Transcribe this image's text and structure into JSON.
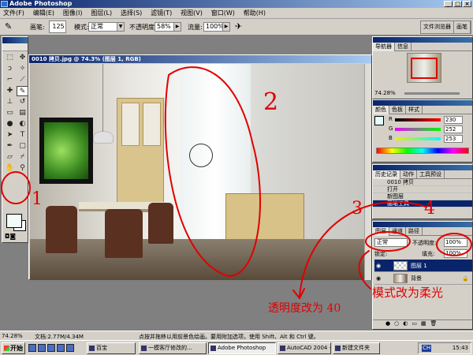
{
  "window": {
    "title": "Adobe Photoshop",
    "controls": [
      "_",
      "□",
      "×"
    ]
  },
  "menu": [
    "文件(F)",
    "编辑(E)",
    "图像(I)",
    "图层(L)",
    "选择(S)",
    "滤镜(T)",
    "视图(V)",
    "窗口(W)",
    "帮助(H)"
  ],
  "options": {
    "brush_label": "画笔:",
    "brush_size": "125",
    "mode_label": "模式:",
    "mode_value": "正常",
    "opacity_label": "不透明度:",
    "opacity_value": "58%",
    "flow_label": "流量:",
    "flow_value": "100%",
    "palette_tabs": [
      "文件浏览器",
      "画笔"
    ]
  },
  "document": {
    "title": "0010 拷贝.jpg @ 74.3% (图层 1, RGB)"
  },
  "navigator": {
    "tabs": [
      "导航器",
      "信息"
    ],
    "zoom": "74.28%"
  },
  "color": {
    "tabs": [
      "颜色",
      "色板",
      "样式"
    ],
    "channels": [
      {
        "label": "R",
        "value": "230"
      },
      {
        "label": "G",
        "value": "252"
      },
      {
        "label": "B",
        "value": "253"
      }
    ],
    "channel_colors": [
      "#e04040",
      "#40c040",
      "#4040e0"
    ]
  },
  "history": {
    "tabs": [
      "历史记录",
      "动作",
      "工具预设"
    ],
    "items": [
      "0010 拷贝",
      "打开",
      "新图层",
      "画笔工具"
    ]
  },
  "layers": {
    "tabs": [
      "图层",
      "通道",
      "路径"
    ],
    "blend_mode": "正常",
    "opacity_label": "不透明度:",
    "opacity_value": "100%",
    "lock_label": "锁定:",
    "fill_label": "填充:",
    "fill_value": "100%",
    "items": [
      {
        "name": "图层 1"
      },
      {
        "name": "背景"
      }
    ]
  },
  "status": {
    "zoom": "74.28%",
    "doc": "文档:2.77M/4.34M",
    "hint": "点按并拖移以用前景色绘画。要用附加选项，使用 Shift、Alt 和 Ctrl 键。"
  },
  "taskbar": {
    "start": "开始",
    "tasks": [
      "百宝",
      "一模客厅修改的...",
      "Adobe Photoshop",
      "AutoCAD 2004 - [D...",
      "新建文件夹"
    ],
    "clock": "15:43",
    "tray": "CH"
  },
  "annotations": {
    "n1": "1",
    "n2": "2",
    "n3": "3",
    "n4": "4",
    "text_opacity": "透明度改为 40",
    "text_mode": "模式改为柔光"
  }
}
